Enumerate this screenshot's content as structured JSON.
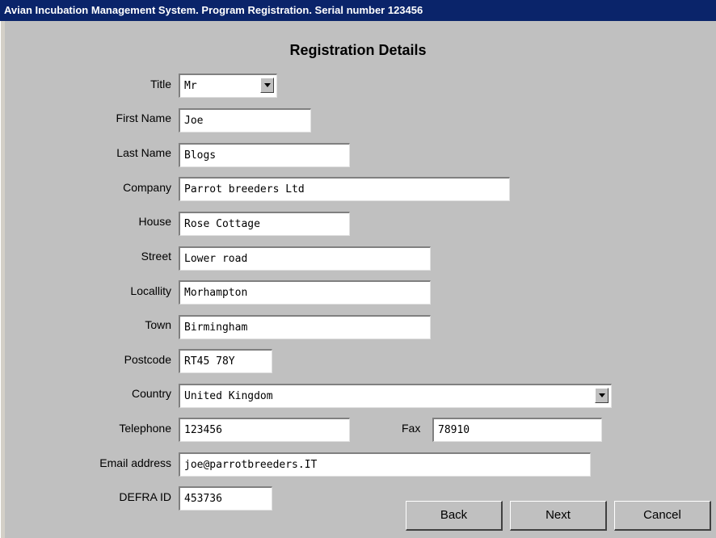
{
  "window": {
    "title": "Avian Incubation Management System.  Program Registration. Serial number 123456"
  },
  "form": {
    "heading": "Registration Details",
    "title_label": "Title",
    "title_value": "Mr",
    "first_name_label": "First Name",
    "first_name_value": "Joe",
    "last_name_label": "Last Name",
    "last_name_value": "Blogs",
    "company_label": "Company",
    "company_value": "Parrot breeders Ltd",
    "house_label": "House",
    "house_value": "Rose Cottage",
    "street_label": "Street",
    "street_value": "Lower road",
    "locality_label": "Locallity",
    "locality_value": "Morhampton",
    "town_label": "Town",
    "town_value": "Birmingham",
    "postcode_label": "Postcode",
    "postcode_value": "RT45 78Y",
    "country_label": "Country",
    "country_value": "United Kingdom",
    "telephone_label": "Telephone",
    "telephone_value": "123456",
    "fax_label": "Fax",
    "fax_value": "78910",
    "email_label": "Email address",
    "email_value": "joe@parrotbreeders.IT",
    "defra_label": "DEFRA ID",
    "defra_value": "453736"
  },
  "buttons": {
    "back": "Back",
    "next": "Next",
    "cancel": "Cancel"
  }
}
